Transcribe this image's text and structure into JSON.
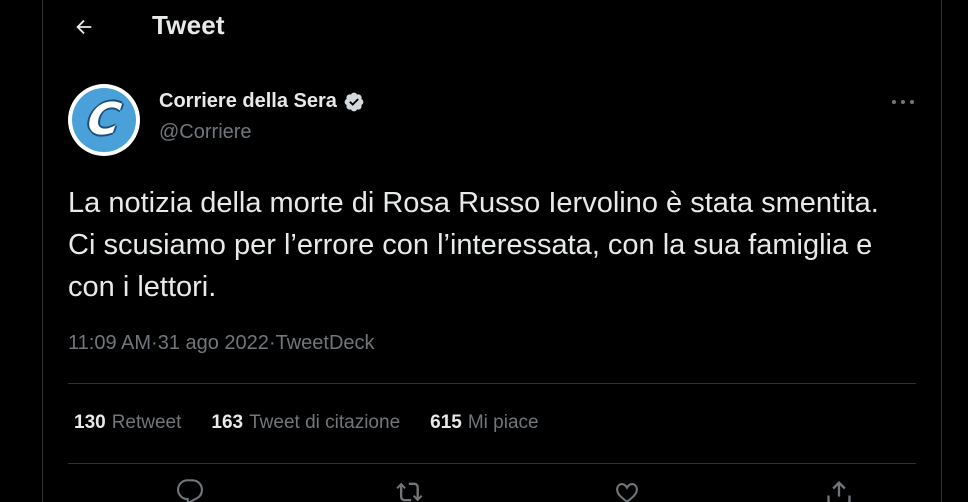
{
  "header": {
    "title": "Tweet"
  },
  "author": {
    "name": "Corriere della Sera",
    "handle": "@Corriere",
    "avatar_letter": "C"
  },
  "tweet": {
    "text": "La notizia della morte di Rosa Russo Iervolino è stata smentita. Ci scusiamo per l’errore con l’interessata, con la sua famiglia e con i lettori.",
    "time": "11:09 AM",
    "separator": " · ",
    "date": "31 ago 2022",
    "source": "TweetDeck"
  },
  "stats": {
    "retweets": {
      "count": "130",
      "label": "Retweet"
    },
    "quotes": {
      "count": "163",
      "label": "Tweet di citazione"
    },
    "likes": {
      "count": "615",
      "label": "Mi piace"
    }
  },
  "colors": {
    "background": "#000000",
    "text": "#e7e9ea",
    "muted": "#71767b",
    "border": "#2f3336",
    "avatar_blue": "#4aa0d8"
  },
  "icons": [
    "back-arrow-icon",
    "verified-icon",
    "more-icon",
    "reply-icon",
    "retweet-icon",
    "like-icon",
    "share-icon"
  ]
}
